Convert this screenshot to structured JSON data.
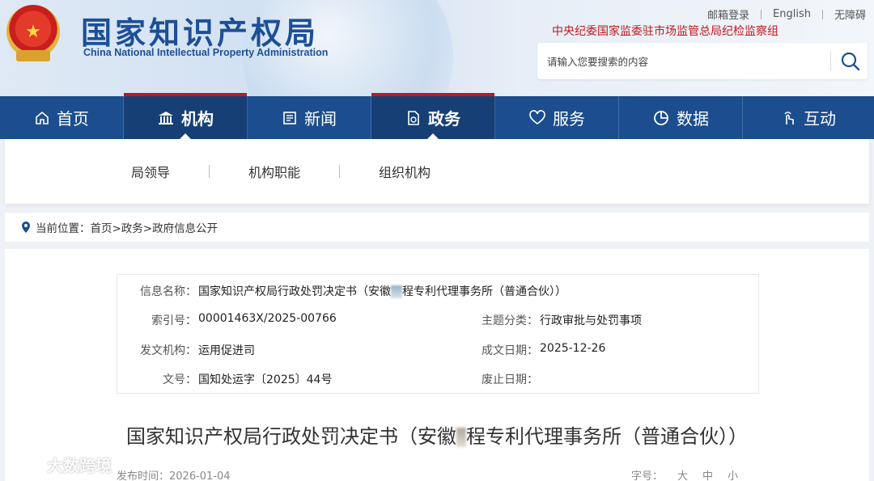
{
  "header": {
    "site_name": "国家知识产权局",
    "site_name_en": "China National Intellectual Property Administration",
    "top_links": [
      "邮箱登录",
      "English",
      "无障碍"
    ],
    "discipline_text": "中央纪委国家监委驻市场监管总局纪检监察组",
    "search_placeholder": "请输入您要搜索的内容"
  },
  "nav": {
    "items": [
      {
        "label": "首页",
        "icon": "home-icon"
      },
      {
        "label": "机构",
        "icon": "institution-icon"
      },
      {
        "label": "新闻",
        "icon": "news-icon"
      },
      {
        "label": "政务",
        "icon": "government-icon"
      },
      {
        "label": "服务",
        "icon": "service-icon"
      },
      {
        "label": "数据",
        "icon": "data-icon"
      },
      {
        "label": "互动",
        "icon": "interaction-icon"
      }
    ],
    "active": [
      "机构",
      "政务"
    ]
  },
  "submenu": {
    "items": [
      "局领导",
      "机构职能",
      "组织机构"
    ]
  },
  "breadcrumb": {
    "prefix": "当前位置：",
    "path": "首页>政务>政府信息公开"
  },
  "info": {
    "name_label": "信息名称：",
    "name_value_a": "国家知识产权局行政处罚决定书（安徽",
    "name_value_b": "程专利代理事务所（普通合伙））",
    "index_label": "索引号：",
    "index_value": "00001463X/2025-00766",
    "category_label": "主题分类：",
    "category_value": "行政审批与处罚事项",
    "issuer_label": "发文机构：",
    "issuer_value": "运用促进司",
    "date_label": "成文日期：",
    "date_value": "2025-12-26",
    "docno_label": "文号：",
    "docno_value": "国知处运字〔2025〕44号",
    "repeal_label": "废止日期：",
    "repeal_value": ""
  },
  "document": {
    "title_a": "国家知识产权局行政处罚决定书（安徽",
    "title_b": "程专利代理事务所（普通合伙））",
    "publish_label": "发布时间：",
    "publish_date": "2026-01-04",
    "fontsize_label": "字号：",
    "fontsize_options": [
      "大",
      "中",
      "小"
    ]
  },
  "watermark": {
    "text": "大数跨境"
  },
  "colors": {
    "brand_blue": "#1c4e8f",
    "active_blue": "#163f76",
    "accent_red": "#c4161c"
  }
}
